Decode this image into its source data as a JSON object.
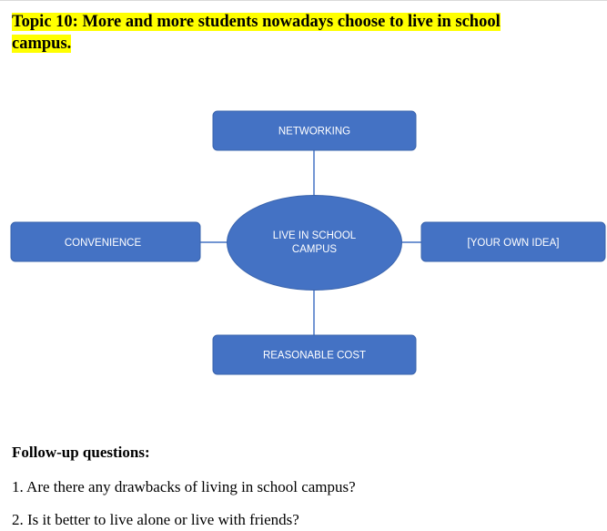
{
  "topic": {
    "line1": "Topic 10: More and more students nowadays choose to live in school",
    "line2": "campus."
  },
  "mindmap": {
    "center_line1": "LIVE IN SCHOOL",
    "center_line2": "CAMPUS",
    "top": "NETWORKING",
    "left": "CONVENIENCE",
    "right": "[YOUR OWN IDEA]",
    "bottom": "REASONABLE COST",
    "colors": {
      "node_fill": "#4472c4",
      "node_border": "#3a64ad",
      "connector": "#4472c4",
      "text": "#ffffff"
    }
  },
  "followup": {
    "heading": "Follow-up questions:",
    "questions": [
      "1. Are there any drawbacks of living in school campus?",
      "2. Is it better to live alone or live with friends?"
    ]
  }
}
